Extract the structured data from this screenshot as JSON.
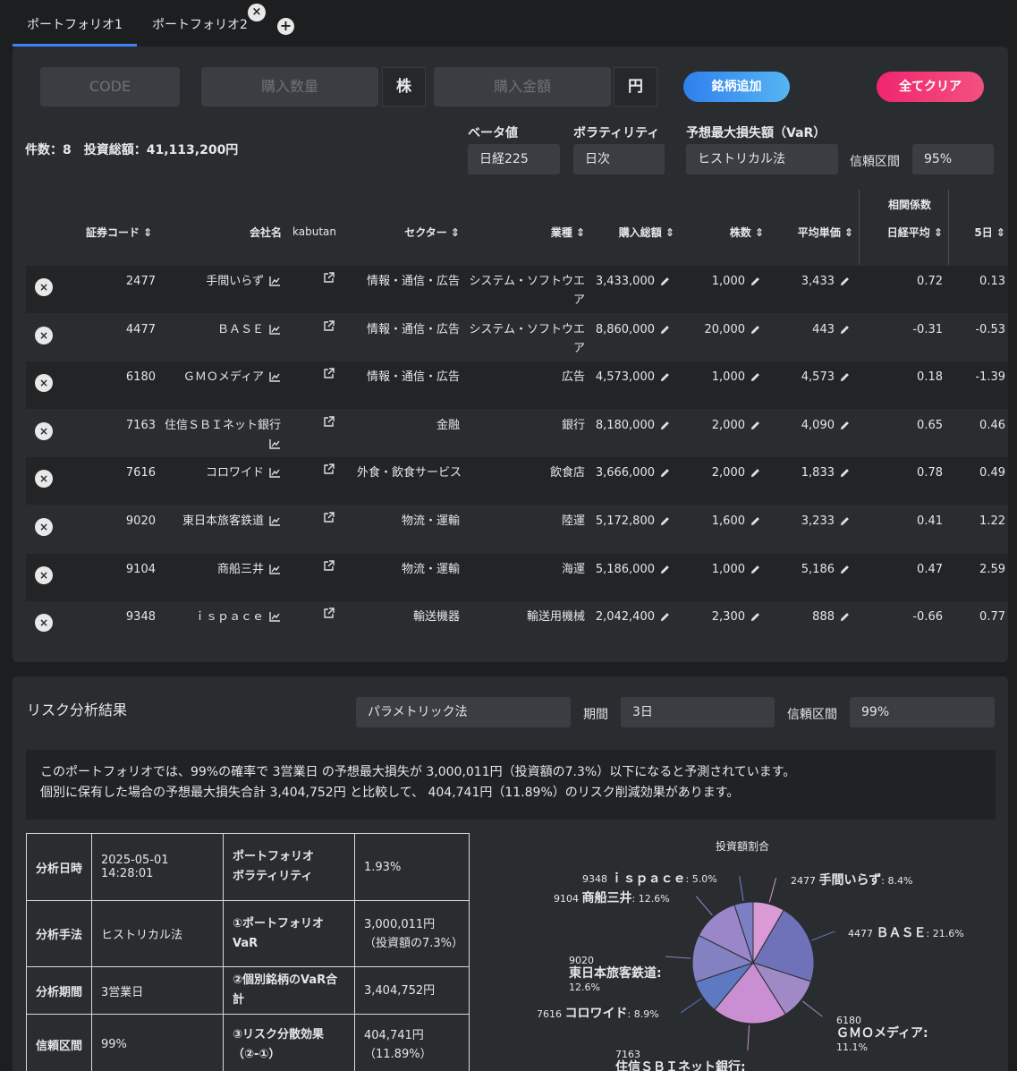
{
  "tabs": [
    {
      "label": "ポートフォリオ1",
      "active": true
    },
    {
      "label": "ポートフォリオ2",
      "active": false
    }
  ],
  "tab_close": "×",
  "tab_add": "+",
  "form": {
    "code_placeholder": "CODE",
    "qty_placeholder": "購入数量",
    "qty_unit": "株",
    "amount_placeholder": "購入金額",
    "amount_unit": "円",
    "add_button": "銘柄追加",
    "clear_button": "全てクリア"
  },
  "summary": "件数：8　投資総額：41,113,200円",
  "settings": {
    "beta_label": "ベータ値",
    "beta_value": "日経225",
    "vol_label": "ボラティリティ",
    "vol_value": "日次",
    "var_label": "予想最大損失額（VaR）",
    "var_method": "ヒストリカル法",
    "ci_label": "信頼区間",
    "ci_value": "95%"
  },
  "table": {
    "corr_group": "相関係数",
    "headers": {
      "code": "証券コード ⇕",
      "company": "会社名",
      "kabutan": "kabutan",
      "sector": "セクター ⇕",
      "industry": "業種 ⇕",
      "total": "購入総額 ⇕",
      "shares": "株数 ⇕",
      "avg": "平均単価 ⇕",
      "nikkei": "日経平均 ⇕",
      "d5": "5日 ⇕"
    },
    "rows": [
      {
        "code": "2477",
        "company": "手間いらず",
        "company2": "",
        "sector": "情報・通信・広告",
        "industry": "システム・ソフトウエ",
        "industry2": "ア",
        "total": "3,433,000",
        "shares": "1,000",
        "avg": "3,433",
        "nikkei": "0.72",
        "d5": "0.13"
      },
      {
        "code": "4477",
        "company": "ＢＡＳＥ",
        "company2": "",
        "sector": "情報・通信・広告",
        "industry": "システム・ソフトウエ",
        "industry2": "ア",
        "total": "8,860,000",
        "shares": "20,000",
        "avg": "443",
        "nikkei": "-0.31",
        "d5": "-0.53"
      },
      {
        "code": "6180",
        "company": "ＧＭＯメディア",
        "company2": "",
        "sector": "情報・通信・広告",
        "industry": "広告",
        "industry2": "",
        "total": "4,573,000",
        "shares": "1,000",
        "avg": "4,573",
        "nikkei": "0.18",
        "d5": "-1.39"
      },
      {
        "code": "7163",
        "company": "住信ＳＢＩネット銀行",
        "company2": "wrap",
        "sector": "金融",
        "industry": "銀行",
        "industry2": "",
        "total": "8,180,000",
        "shares": "2,000",
        "avg": "4,090",
        "nikkei": "0.65",
        "d5": "0.46"
      },
      {
        "code": "7616",
        "company": "コロワイド",
        "company2": "",
        "sector": "外食・飲食サービス",
        "industry": "飲食店",
        "industry2": "",
        "total": "3,666,000",
        "shares": "2,000",
        "avg": "1,833",
        "nikkei": "0.78",
        "d5": "0.49"
      },
      {
        "code": "9020",
        "company": "東日本旅客鉄道",
        "company2": "",
        "sector": "物流・運輸",
        "industry": "陸運",
        "industry2": "",
        "total": "5,172,800",
        "shares": "1,600",
        "avg": "3,233",
        "nikkei": "0.41",
        "d5": "1.22"
      },
      {
        "code": "9104",
        "company": "商船三井",
        "company2": "",
        "sector": "物流・運輸",
        "industry": "海運",
        "industry2": "",
        "total": "5,186,000",
        "shares": "1,000",
        "avg": "5,186",
        "nikkei": "0.47",
        "d5": "2.59"
      },
      {
        "code": "9348",
        "company": "ｉｓｐａｃｅ",
        "company2": "",
        "sector": "輸送機器",
        "industry": "輸送用機械",
        "industry2": "",
        "total": "2,042,400",
        "shares": "2,300",
        "avg": "888",
        "nikkei": "-0.66",
        "d5": "0.77"
      }
    ]
  },
  "risk": {
    "title": "リスク分析結果",
    "method": "パラメトリック法",
    "period_label": "期間",
    "period_value": "3日",
    "ci_label": "信頼区間",
    "ci_value": "99%",
    "message_line1": "このポートフォリオでは、99%の確率で 3営業日 の予想最大損失が 3,000,011円（投資額の7.3%）以下になると予測されています。",
    "message_line2": "個別に保有した場合の予想最大損失合計 3,404,752円 と比較して、 404,741円（11.89%）のリスク削減効果があります。",
    "rows": [
      {
        "k1": "分析日時",
        "v1": "2025-05-01 14:28:01",
        "k2": "ポートフォリオ\nボラティリティ",
        "v2": "1.93%"
      },
      {
        "k1": "分析手法",
        "v1": "ヒストリカル法",
        "k2": "①ポートフォリオVaR",
        "v2": "3,000,011円\n（投資額の7.3%）"
      },
      {
        "k1": "分析期間",
        "v1": "3営業日",
        "k2": "②個別銘柄のVaR合計",
        "v2": "3,404,752円"
      },
      {
        "k1": "信頼区間",
        "v1": "99%",
        "k2": "③リスク分散効果\n（②-①）",
        "v2": "404,741円\n（11.89%）"
      }
    ]
  },
  "chart_data": {
    "type": "pie",
    "title": "投資額割合",
    "slices": [
      {
        "code": "2477",
        "name": "手間いらず",
        "value": 8.4,
        "color": "#d99ad6"
      },
      {
        "code": "4477",
        "name": "ＢＡＳＥ",
        "value": 21.6,
        "color": "#6f72b8"
      },
      {
        "code": "6180",
        "name": "ＧＭＯメディア",
        "value": 11.1,
        "color": "#9f8ac6"
      },
      {
        "code": "7163",
        "name": "住信ＳＢＩネット銀行",
        "value": 19.9,
        "color": "#c98fd2"
      },
      {
        "code": "7616",
        "name": "コロワイド",
        "value": 8.9,
        "color": "#5e78c2"
      },
      {
        "code": "9020",
        "name": "東日本旅客鉄道",
        "value": 12.6,
        "color": "#8481c2"
      },
      {
        "code": "9104",
        "name": "商船三井",
        "value": 12.6,
        "color": "#9a86c9"
      },
      {
        "code": "9348",
        "name": "ｉｓｐａｃｅ",
        "value": 5.0,
        "color": "#7c7fc4"
      }
    ],
    "labels": {
      "2477": "2477 手間いらず: 8.4%",
      "4477": "4477 ＢＡＳＥ: 21.6%",
      "6180": "6180 ＧＭＯメディア: 11.1%",
      "7163": "7163 住信ＳＢＩネット銀行:",
      "7616": "7616 コロワイド: 8.9%",
      "9020": "9020 東日本旅客鉄道: 12.6%",
      "9104": "9104 商船三井: 12.6%",
      "9348": "9348 ｉｓｐａｃｅ: 5.0%"
    }
  }
}
